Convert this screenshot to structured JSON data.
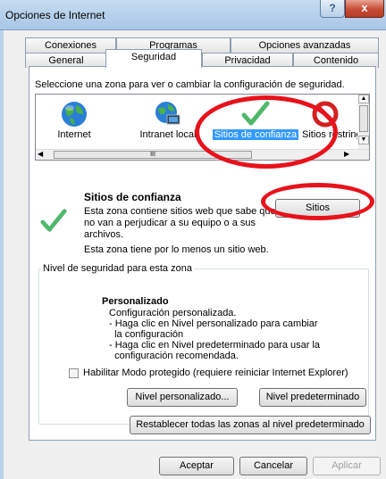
{
  "window": {
    "title": "Opciones de Internet",
    "help_label": "?",
    "close_label": "x"
  },
  "tabs_row1": [
    "Conexiones",
    "Programas",
    "Opciones avanzadas"
  ],
  "tabs_row2": [
    "General",
    "Seguridad",
    "Privacidad",
    "Contenido"
  ],
  "active_tab": "Seguridad",
  "zones": {
    "instruction": "Seleccione una zona para ver o cambiar la configuración de seguridad.",
    "items": [
      {
        "label": "Internet",
        "icon": "globe-icon"
      },
      {
        "label": "Intranet local",
        "icon": "intranet-icon"
      },
      {
        "label": "Sitios de confianza",
        "icon": "checkmark-icon",
        "selected": true
      },
      {
        "label": "Sitios restringidos",
        "icon": "restricted-icon"
      }
    ],
    "scroll_thumb": "III"
  },
  "selected_zone": {
    "title": "Sitios de confianza",
    "description": "Esta zona contiene sitios web que sabe que no van a perjudicar a su equipo o a sus archivos.",
    "note": "Esta zona tiene por lo menos un sitio web.",
    "sites_button": "Sitios"
  },
  "security_level": {
    "legend": "Nivel de seguridad para esta zona",
    "level_title": "Personalizado",
    "lines": [
      "Configuración personalizada.",
      "- Haga clic en Nivel personalizado para cambiar",
      "  la configuración",
      "- Haga clic en Nivel predeterminado para usar la",
      "  configuración recomendada."
    ],
    "protected_mode_label": "Habilitar Modo protegido (requiere reiniciar Internet Explorer)",
    "protected_mode_checked": false,
    "custom_level_button": "Nivel personalizado...",
    "default_level_button": "Nivel predeterminado"
  },
  "reset_all_button": "Restablecer todas las zonas al nivel predeterminado",
  "footer": {
    "ok": "Aceptar",
    "cancel": "Cancelar",
    "apply": "Aplicar"
  },
  "colors": {
    "highlight": "#3399ff",
    "annotation": "#e8121c",
    "check_green": "#4fb86b"
  }
}
